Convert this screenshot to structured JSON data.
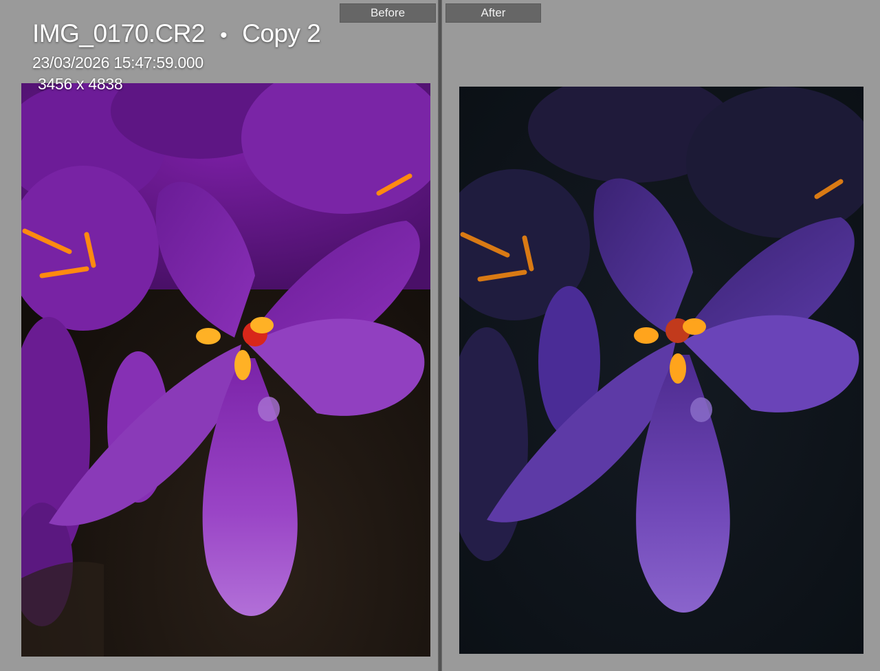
{
  "compare_view": {
    "before_label": "Before",
    "after_label": "After"
  },
  "photo_info": {
    "filename": "IMG_0170.CR2",
    "separator": "•",
    "copy_name": "Copy 2",
    "capture_time": "23/03/2026 15:47:59.000",
    "dimensions": "3456 x 4838"
  },
  "colors": {
    "panel_background": "#9b9b9b",
    "label_background": "#666666",
    "before_petal": "#8a2fb8",
    "after_petal": "#6a3cc0",
    "stamen": "#ffa41c"
  }
}
